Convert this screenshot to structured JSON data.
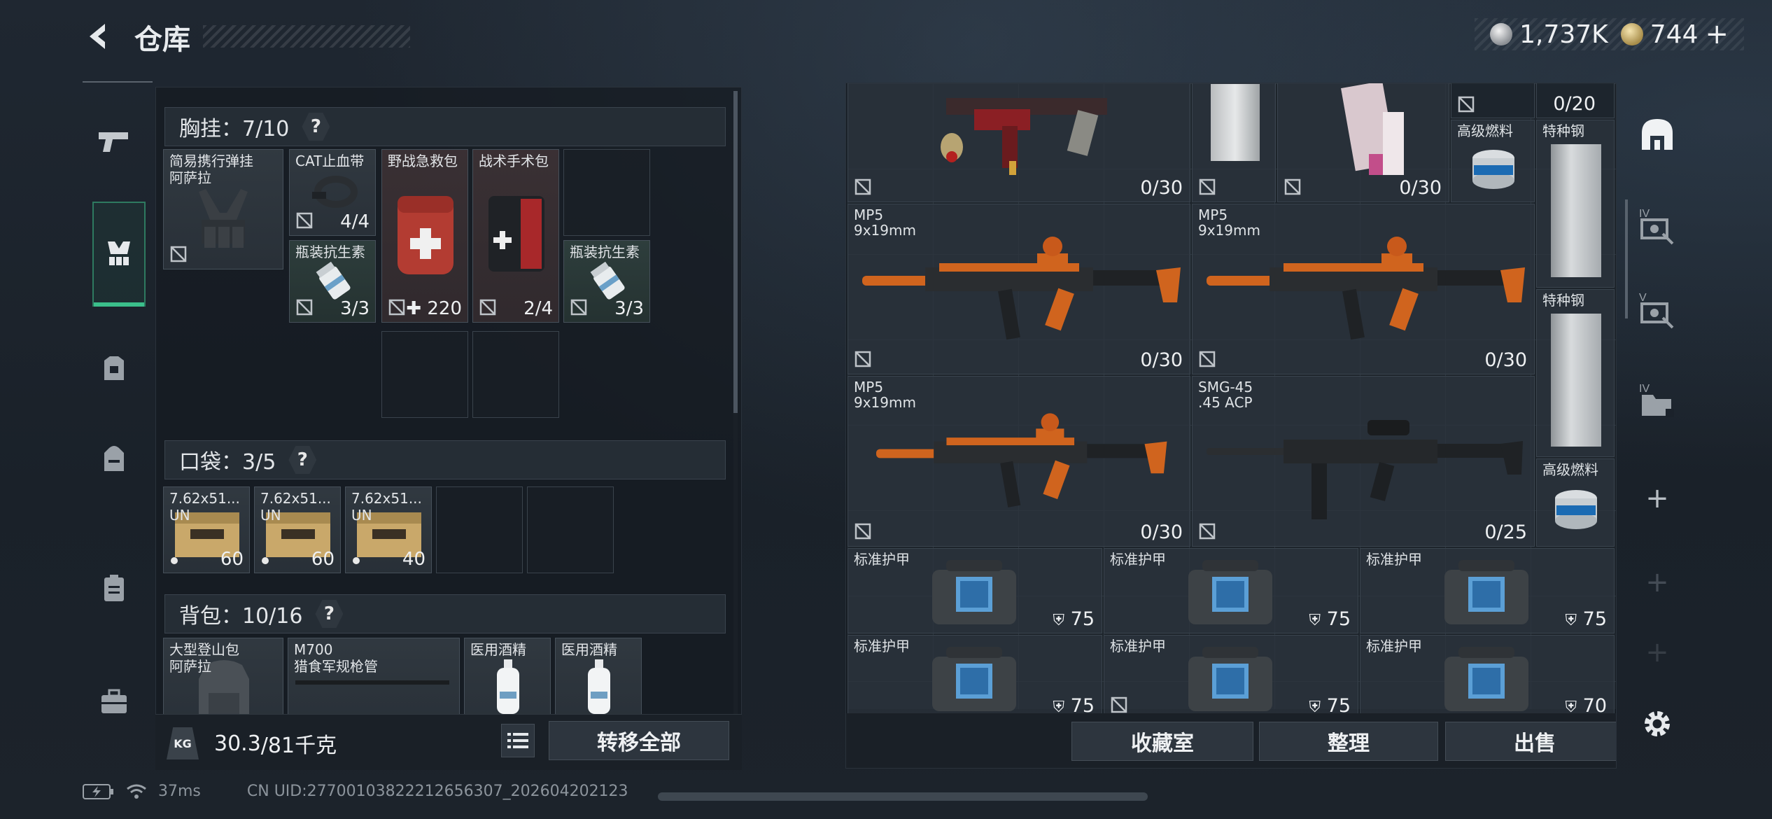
{
  "header": {
    "title": "仓库",
    "currency": [
      {
        "icon": "silver-coin-icon",
        "value": "1,737K"
      },
      {
        "icon": "gold-coin-icon",
        "value": "744"
      }
    ],
    "add_symbol": "+"
  },
  "sidebar": {
    "items": [
      {
        "icon": "pistol-icon",
        "active": false
      },
      {
        "icon": "chest-rig-icon",
        "active": true
      },
      {
        "icon": "helmet-icon",
        "active": false
      },
      {
        "icon": "backpack-icon",
        "active": false
      },
      {
        "icon": "clipboard-icon",
        "active": false
      },
      {
        "icon": "toolbox-icon",
        "active": false
      }
    ]
  },
  "left": {
    "chest_rig": {
      "label": "胸挂：",
      "capacity": "7/10",
      "help": "?",
      "items": [
        {
          "name": "简易携行弹挂\n阿萨拉",
          "count": ""
        },
        {
          "name": "CAT止血带",
          "count": "4/4"
        },
        {
          "name": "野战急救包",
          "count": "220",
          "prefix": "✚"
        },
        {
          "name": "战术手术包",
          "count": "2/4"
        },
        {
          "name": "瓶装抗生素",
          "count": "3/3"
        },
        {
          "name": "瓶装抗生素",
          "count": "3/3"
        }
      ]
    },
    "pocket": {
      "label": "口袋：",
      "capacity": "3/5",
      "help": "?",
      "items": [
        {
          "name": "7.62x51...\nUN",
          "count": "60"
        },
        {
          "name": "7.62x51...\nUN",
          "count": "60"
        },
        {
          "name": "7.62x51...\nUN",
          "count": "40"
        }
      ]
    },
    "backpack": {
      "label": "背包：",
      "capacity": "10/16",
      "help": "?",
      "items": [
        {
          "name": "大型登山包\n阿萨拉"
        },
        {
          "name": "M700\n猎食军规枪管"
        },
        {
          "name": "医用酒精"
        },
        {
          "name": "医用酒精"
        }
      ]
    },
    "weight": {
      "value": "30.3",
      "max": "/81千克",
      "badge": "KG"
    },
    "transfer_all": "转移全部"
  },
  "right": {
    "top_items": [
      {
        "name": "",
        "count": "0/30"
      },
      {
        "name": "",
        "count": "0/30"
      },
      {
        "name": "",
        "count": "0/20"
      }
    ],
    "fuel_1": "高级燃料",
    "steel_1": "特种钢",
    "steel_2": "特种钢",
    "fuel_2": "高级燃料",
    "weapons": [
      {
        "name": "MP5\n9x19mm",
        "count": "0/30"
      },
      {
        "name": "MP5\n9x19mm",
        "count": "0/30"
      },
      {
        "name": "MP5\n9x19mm",
        "count": "0/30"
      },
      {
        "name": "SMG-45\n.45 ACP",
        "count": "0/25"
      }
    ],
    "armor": [
      {
        "name": "标准护甲",
        "value": "75"
      },
      {
        "name": "标准护甲",
        "value": "75"
      },
      {
        "name": "标准护甲",
        "value": "75"
      },
      {
        "name": "标准护甲",
        "value": "75"
      },
      {
        "name": "标准护甲",
        "value": "75"
      },
      {
        "name": "标准护甲",
        "value": "70"
      }
    ],
    "buttons": {
      "favorites": "收藏室",
      "organize": "整理",
      "sell": "出售"
    }
  },
  "rail": {
    "items": [
      "home-stash-icon",
      "tier-iv-icon",
      "tier-v-icon",
      "tier-iv-folder-icon",
      "add-icon",
      "add-icon",
      "add-icon"
    ],
    "tier_labels": [
      "IV",
      "V",
      "IV"
    ],
    "plus": "+"
  },
  "status": {
    "ping": "37ms",
    "uid": "CN UID:27700103822212656307_202604202123"
  }
}
